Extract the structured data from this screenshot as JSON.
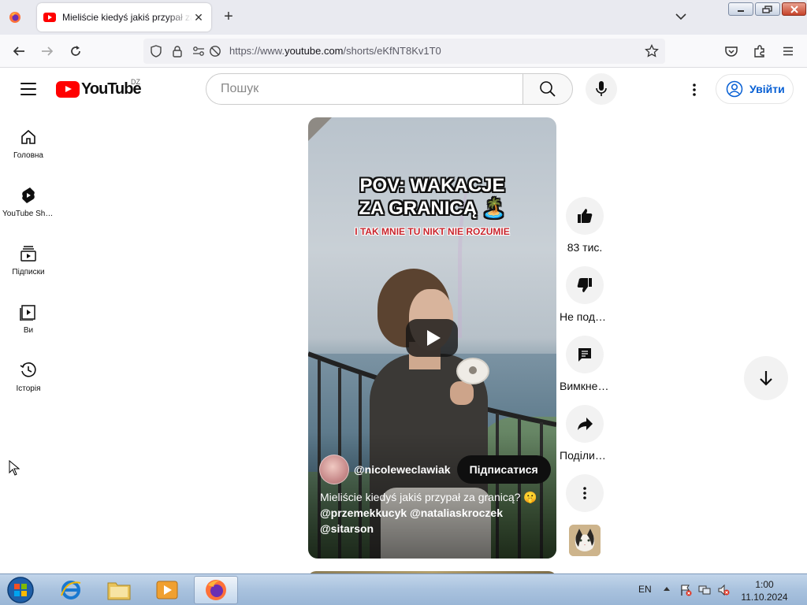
{
  "browser": {
    "tab_title": "Mieliście kiedyś jakiś przypał za granicą?",
    "url_prefix": "https://www.",
    "url_domain": "youtube.com",
    "url_path": "/shorts/eKfNT8Kv1T0"
  },
  "header": {
    "logo_text": "YouTube",
    "country_code": "DZ",
    "search_placeholder": "Пошук",
    "signin_label": "Увійти"
  },
  "sidebar": {
    "items": [
      {
        "label": "Головна",
        "icon": "home-icon"
      },
      {
        "label": "YouTube Shorts",
        "icon": "shorts-icon"
      },
      {
        "label": "Підписки",
        "icon": "subscriptions-icon"
      },
      {
        "label": "Ви",
        "icon": "you-icon"
      },
      {
        "label": "Історія",
        "icon": "history-icon"
      }
    ]
  },
  "short": {
    "overlay_title_line1": "POV: WAKACJE",
    "overlay_title_line2": "ZA GRANICĄ 🏝️",
    "overlay_subtitle": "I TAK MNIE TU NIKT NIE ROZUMIE",
    "channel_name": "@nicoleweclawiak",
    "subscribe_label": "Підписатися",
    "caption_text": "Mieliście kiedyś jakiś przypał za granicą? 🤫",
    "caption_tags": "@przemekkucyk @nataliaskroczek @sitarson"
  },
  "actions": {
    "like_count": "83 тис.",
    "dislike_label": "Не подобається",
    "comments_label": "Вимкнено коментарі",
    "share_label": "Поділитися"
  },
  "taskbar": {
    "language": "EN",
    "time": "1:00",
    "date": "11.10.2024"
  },
  "colors": {
    "youtube_red": "#ff0000",
    "signin_blue": "#065fd4",
    "taskbar": "#a9c2de"
  }
}
